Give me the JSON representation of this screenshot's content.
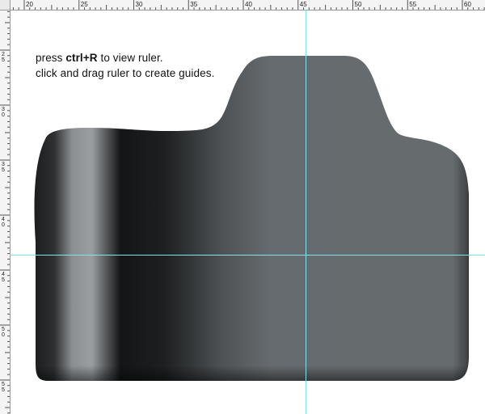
{
  "instructions": {
    "line1_prefix": "press ",
    "line1_shortcut": "ctrl+R",
    "line1_suffix": " to view ruler.",
    "line2": "click and drag ruler to create guides."
  },
  "top_ruler": {
    "labels": [
      "20",
      "25",
      "30",
      "35",
      "40",
      "45",
      "50",
      "55",
      "60"
    ]
  },
  "left_ruler": {
    "labels": [
      "2\n5",
      "3\n0",
      "3\n5",
      "4\n0",
      "4\n5",
      "5\n0",
      "5\n5"
    ]
  },
  "colors": {
    "guide": "#7fe3ec",
    "shape_light": "#656a6e",
    "shape_dark": "#141516",
    "ruler_bg": "#f4f4f4"
  }
}
